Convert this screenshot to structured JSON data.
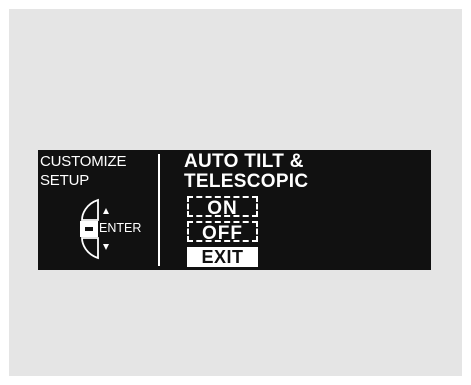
{
  "screen": {
    "left_title": [
      "CUSTOMIZE",
      "SETUP"
    ],
    "enter_label": "ENTER",
    "right_title": [
      "AUTO TILT &",
      "TELESCOPIC"
    ],
    "options": [
      {
        "label": "ON",
        "selected": false
      },
      {
        "label": "OFF",
        "selected": false
      }
    ],
    "exit_label": "EXIT"
  },
  "icons": [
    "enter-button-icon",
    "up-arrow-icon",
    "down-arrow-icon"
  ],
  "colors": {
    "screen_bg": "#111111",
    "text": "#ffffff",
    "outer_bg": "#e5e5e5"
  }
}
